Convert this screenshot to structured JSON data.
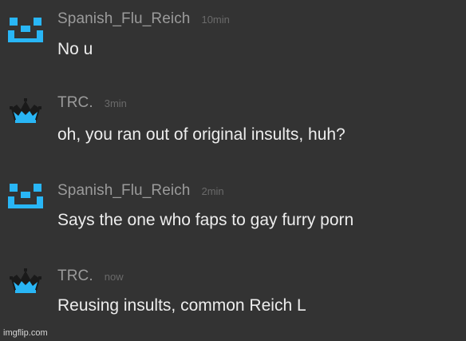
{
  "colors": {
    "background": "#333333",
    "username": "#9b9b9b",
    "timestamp": "#6a6a6a",
    "message_text": "#ededed",
    "avatar_blue": "#29b6f6",
    "crown_dark": "#1a1a1a"
  },
  "messages": [
    {
      "avatar_icon": "blue-smiley-blocks-icon",
      "username": "Spanish_Flu_Reich",
      "time": "10min",
      "text": "No u"
    },
    {
      "avatar_icon": "crown-icon",
      "username": "TRC.",
      "time": "3min",
      "text": "oh, you ran out of original insults, huh?"
    },
    {
      "avatar_icon": "blue-smiley-blocks-icon",
      "username": "Spanish_Flu_Reich",
      "time": "2min",
      "text": "Says the one who faps to gay furry porn"
    },
    {
      "avatar_icon": "crown-icon",
      "username": "TRC.",
      "time": "now",
      "text": "Reusing insults, common Reich L"
    }
  ],
  "watermark": "imgflip.com"
}
